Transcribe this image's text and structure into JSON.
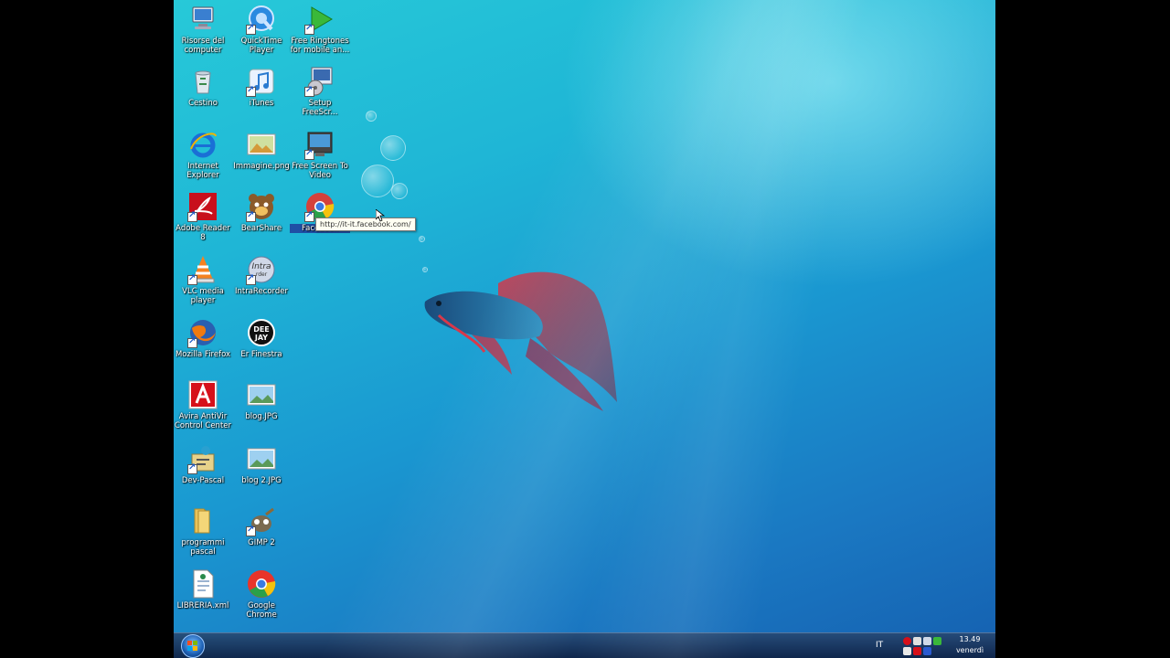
{
  "desktop": {
    "icons": [
      {
        "label": "Risorse del computer",
        "icon": "computer-icon"
      },
      {
        "label": "QuickTime Player",
        "icon": "quicktime-icon"
      },
      {
        "label": "Free Ringtones for mobile an...",
        "icon": "ringtones-icon"
      },
      {
        "label": "Cestino",
        "icon": "recycle-bin-icon"
      },
      {
        "label": "iTunes",
        "icon": "itunes-icon"
      },
      {
        "label": "Setup FreeScr...",
        "icon": "setup-icon"
      },
      {
        "label": "Internet Explorer",
        "icon": "internet-explorer-icon"
      },
      {
        "label": "Immagine.png",
        "icon": "image-file-icon"
      },
      {
        "label": "Free Screen To Video",
        "icon": "screen-to-video-icon"
      },
      {
        "label": "Adobe Reader 8",
        "icon": "adobe-reader-icon"
      },
      {
        "label": "BearShare",
        "icon": "bearshare-icon"
      },
      {
        "label": "Facebook",
        "icon": "facebook-shortcut-icon"
      },
      {
        "label": "VLC media player",
        "icon": "vlc-icon"
      },
      {
        "label": "IntraRecorder",
        "icon": "intrarecorder-icon"
      },
      {
        "label": "Mozilla Firefox",
        "icon": "firefox-icon"
      },
      {
        "label": "Er Finestra",
        "icon": "deejay-icon"
      },
      {
        "label": "Avira AntiVir Control Center",
        "icon": "avira-icon"
      },
      {
        "label": "blog.JPG",
        "icon": "jpg-file-icon"
      },
      {
        "label": "Dev-Pascal",
        "icon": "dev-pascal-icon"
      },
      {
        "label": "blog 2.JPG",
        "icon": "jpg-file-icon"
      },
      {
        "label": "programmi pascal",
        "icon": "folder-icon"
      },
      {
        "label": "GIMP 2",
        "icon": "gimp-icon"
      },
      {
        "label": "LIBRERIA.xml",
        "icon": "xml-file-icon"
      },
      {
        "label": "Google Chrome",
        "icon": "chrome-icon"
      }
    ],
    "tooltip": "http://it-it.facebook.com/"
  },
  "taskbar": {
    "language": "IT",
    "clock_time": "13.49",
    "clock_day": "venerdì"
  },
  "colors": {
    "taskbar": "#1a2f55",
    "selection": "#1f4fa5"
  }
}
